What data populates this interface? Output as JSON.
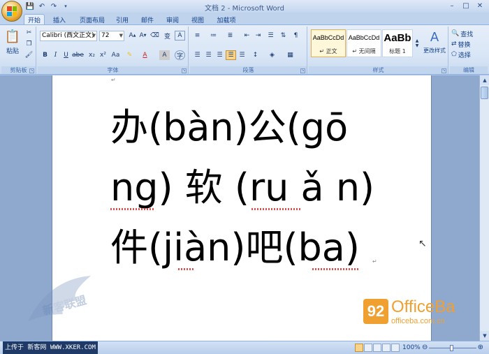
{
  "window": {
    "title": "文档 2 - Microsoft Word"
  },
  "quick_access": {
    "save_icon": "save-icon",
    "undo_icon": "undo-icon",
    "redo_icon": "redo-icon"
  },
  "tabs": [
    {
      "label": "开始",
      "active": true
    },
    {
      "label": "插入",
      "active": false
    },
    {
      "label": "页面布局",
      "active": false
    },
    {
      "label": "引用",
      "active": false
    },
    {
      "label": "邮件",
      "active": false
    },
    {
      "label": "审阅",
      "active": false
    },
    {
      "label": "视图",
      "active": false
    },
    {
      "label": "加载项",
      "active": false
    }
  ],
  "ribbon": {
    "clipboard": {
      "label": "剪贴板",
      "paste_label": "粘贴"
    },
    "font": {
      "label": "字体",
      "font_name": "Calibri (西文正文)",
      "font_size": "72"
    },
    "paragraph": {
      "label": "段落"
    },
    "styles": {
      "label": "样式",
      "items": [
        {
          "sample": "AaBbCcDd",
          "name": "↵ 正文",
          "selected": true
        },
        {
          "sample": "AaBbCcDd",
          "name": "↵ 无间隔",
          "selected": false
        },
        {
          "sample": "AaBb",
          "name": "标题 1",
          "selected": false
        }
      ],
      "change_styles_label": "更改样式"
    },
    "editing": {
      "label": "编辑",
      "find_label": "查找",
      "replace_label": "替换",
      "select_label": "选择"
    }
  },
  "document": {
    "lines": [
      "办(bàn)公(gō",
      "ng) 软 (ru ǎ n)",
      "件(jiàn)吧(ba)"
    ]
  },
  "watermark": {
    "brand_badge": "92",
    "brand_name": "OfficeBa",
    "brand_url": "officeba.com.cn",
    "wing_text": "新客联盟"
  },
  "statusbar": {
    "upload_text": "上传于 新客网 WWW.XKER.COM",
    "zoom": "100%"
  },
  "colors": {
    "accent": "#15428b",
    "brand": "#f0a030",
    "ribbon_bg": "#dbe7f6"
  }
}
